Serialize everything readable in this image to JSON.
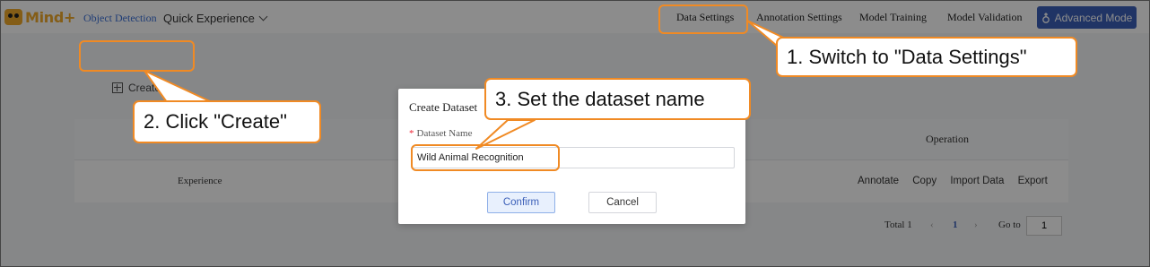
{
  "app": {
    "logo_text": "Mind+",
    "nav_object_detection": "Object Detection",
    "nav_quick_experience": "Quick Experience",
    "tabs": [
      "Data Settings",
      "Annotation Settings",
      "Model Training",
      "Model Validation"
    ],
    "advanced_mode": "Advanced Mode"
  },
  "page": {
    "create_label": "Create",
    "operation_header": "Operation",
    "row_name": "Experience",
    "row_ops": [
      "Annotate",
      "Copy",
      "Import Data",
      "Export"
    ],
    "total_label": "Total 1",
    "current_page": "1",
    "goto_label": "Go to",
    "goto_value": "1"
  },
  "dialog": {
    "title": "Create Dataset",
    "required_mark": "*",
    "field_label": "Dataset Name",
    "field_value": "Wild Animal Recognition",
    "confirm": "Confirm",
    "cancel": "Cancel"
  },
  "callouts": {
    "step1": "1. Switch to \"Data Settings\"",
    "step2": "2. Click \"Create\"",
    "step3": "3. Set the dataset name"
  },
  "colors": {
    "accent": "#f08a24",
    "primary": "#3b5fb8"
  }
}
